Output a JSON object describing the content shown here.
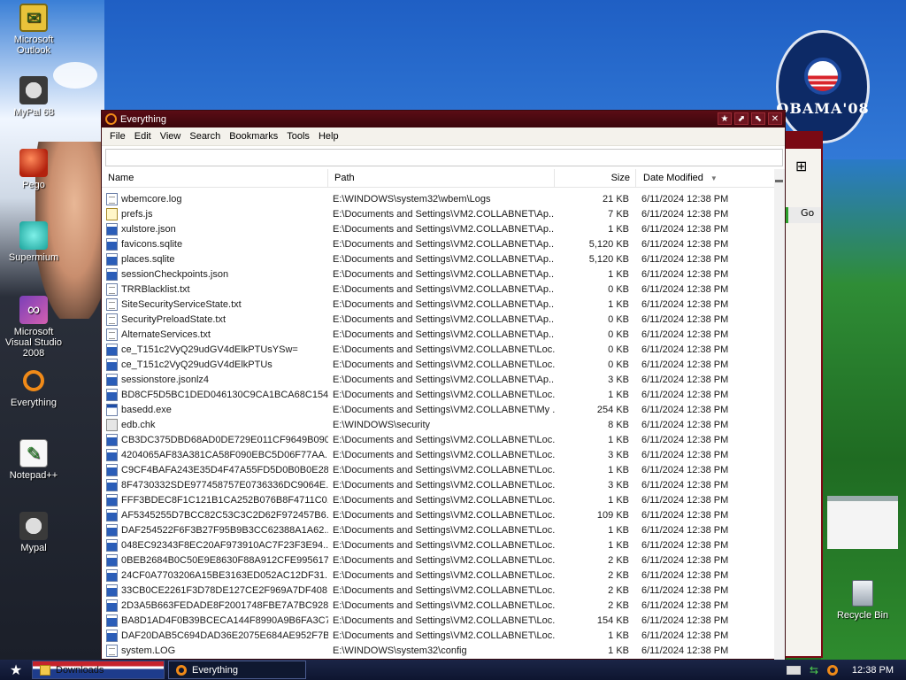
{
  "desktop": {
    "icons": [
      {
        "label": "Microsoft Outlook",
        "icon": "outlook-icon"
      },
      {
        "label": "MyPal 68",
        "icon": "raccoon-icon"
      },
      {
        "label": "Pego",
        "icon": "pego-icon"
      },
      {
        "label": "Supermium",
        "icon": "supermium-icon"
      },
      {
        "label": "Microsoft Visual Studio 2008",
        "icon": "visual-studio-icon"
      },
      {
        "label": "Everything",
        "icon": "everything-icon"
      },
      {
        "label": "Notepad++",
        "icon": "notepad-icon"
      },
      {
        "label": "Mypal",
        "icon": "raccoon-icon"
      }
    ],
    "badge_text": "OBAMA'08",
    "recycle_bin": "Recycle Bin",
    "bg_window_button": "Go"
  },
  "window": {
    "title": "Everything",
    "title_buttons": [
      "★",
      "⬈",
      "⬉",
      "✕"
    ],
    "menu": [
      "File",
      "Edit",
      "View",
      "Search",
      "Bookmarks",
      "Tools",
      "Help"
    ],
    "search": {
      "value": "",
      "placeholder": ""
    },
    "columns": {
      "name": "Name",
      "path": "Path",
      "size": "Size",
      "date": "Date Modified",
      "sort_arrow": "▼"
    },
    "rows": [
      {
        "icon": "doc",
        "name": "wbemcore.log",
        "path": "E:\\WINDOWS\\system32\\wbem\\Logs",
        "size": "21 KB",
        "date": "6/11/2024 12:38 PM"
      },
      {
        "icon": "js",
        "name": "prefs.js",
        "path": "E:\\Documents and Settings\\VM2.COLLABNET\\Ap...",
        "size": "7 KB",
        "date": "6/11/2024 12:38 PM"
      },
      {
        "icon": "blue",
        "name": "xulstore.json",
        "path": "E:\\Documents and Settings\\VM2.COLLABNET\\Ap...",
        "size": "1 KB",
        "date": "6/11/2024 12:38 PM"
      },
      {
        "icon": "blue",
        "name": "favicons.sqlite",
        "path": "E:\\Documents and Settings\\VM2.COLLABNET\\Ap...",
        "size": "5,120 KB",
        "date": "6/11/2024 12:38 PM"
      },
      {
        "icon": "blue",
        "name": "places.sqlite",
        "path": "E:\\Documents and Settings\\VM2.COLLABNET\\Ap...",
        "size": "5,120 KB",
        "date": "6/11/2024 12:38 PM"
      },
      {
        "icon": "blue",
        "name": "sessionCheckpoints.json",
        "path": "E:\\Documents and Settings\\VM2.COLLABNET\\Ap...",
        "size": "1 KB",
        "date": "6/11/2024 12:38 PM"
      },
      {
        "icon": "doc",
        "name": "TRRBlacklist.txt",
        "path": "E:\\Documents and Settings\\VM2.COLLABNET\\Ap...",
        "size": "0 KB",
        "date": "6/11/2024 12:38 PM"
      },
      {
        "icon": "doc",
        "name": "SiteSecurityServiceState.txt",
        "path": "E:\\Documents and Settings\\VM2.COLLABNET\\Ap...",
        "size": "1 KB",
        "date": "6/11/2024 12:38 PM"
      },
      {
        "icon": "doc",
        "name": "SecurityPreloadState.txt",
        "path": "E:\\Documents and Settings\\VM2.COLLABNET\\Ap...",
        "size": "0 KB",
        "date": "6/11/2024 12:38 PM"
      },
      {
        "icon": "doc",
        "name": "AlternateServices.txt",
        "path": "E:\\Documents and Settings\\VM2.COLLABNET\\Ap...",
        "size": "0 KB",
        "date": "6/11/2024 12:38 PM"
      },
      {
        "icon": "blue",
        "name": "ce_T151c2VyQ29udGV4dElkPTUsYSw=",
        "path": "E:\\Documents and Settings\\VM2.COLLABNET\\Loc...",
        "size": "0 KB",
        "date": "6/11/2024 12:38 PM"
      },
      {
        "icon": "blue",
        "name": "ce_T151c2VyQ29udGV4dElkPTUs",
        "path": "E:\\Documents and Settings\\VM2.COLLABNET\\Loc...",
        "size": "0 KB",
        "date": "6/11/2024 12:38 PM"
      },
      {
        "icon": "blue",
        "name": "sessionstore.jsonlz4",
        "path": "E:\\Documents and Settings\\VM2.COLLABNET\\Ap...",
        "size": "3 KB",
        "date": "6/11/2024 12:38 PM"
      },
      {
        "icon": "blue",
        "name": "BD8CF5D5BC1DED046130C9CA1BCA68C154...",
        "path": "E:\\Documents and Settings\\VM2.COLLABNET\\Loc...",
        "size": "1 KB",
        "date": "6/11/2024 12:38 PM"
      },
      {
        "icon": "exe",
        "name": "basedd.exe",
        "path": "E:\\Documents and Settings\\VM2.COLLABNET\\My ...",
        "size": "254 KB",
        "date": "6/11/2024 12:38 PM"
      },
      {
        "icon": "chk",
        "name": "edb.chk",
        "path": "E:\\WINDOWS\\security",
        "size": "8 KB",
        "date": "6/11/2024 12:38 PM"
      },
      {
        "icon": "blue",
        "name": "CB3DC375DBD68AD0DE729E011CF9649B090...",
        "path": "E:\\Documents and Settings\\VM2.COLLABNET\\Loc...",
        "size": "1 KB",
        "date": "6/11/2024 12:38 PM"
      },
      {
        "icon": "blue",
        "name": "4204065AF83A381CA58F090EBC5D06F77AA...",
        "path": "E:\\Documents and Settings\\VM2.COLLABNET\\Loc...",
        "size": "3 KB",
        "date": "6/11/2024 12:38 PM"
      },
      {
        "icon": "blue",
        "name": "C9CF4BAFA243E35D4F47A55FD5D0B0B0E28...",
        "path": "E:\\Documents and Settings\\VM2.COLLABNET\\Loc...",
        "size": "1 KB",
        "date": "6/11/2024 12:38 PM"
      },
      {
        "icon": "blue",
        "name": "8F4730332SDE977458757E0736336DC9064E...",
        "path": "E:\\Documents and Settings\\VM2.COLLABNET\\Loc...",
        "size": "3 KB",
        "date": "6/11/2024 12:38 PM"
      },
      {
        "icon": "blue",
        "name": "FFF3BDEC8F1C121B1CA252B076B8F4711C0...",
        "path": "E:\\Documents and Settings\\VM2.COLLABNET\\Loc...",
        "size": "1 KB",
        "date": "6/11/2024 12:38 PM"
      },
      {
        "icon": "blue",
        "name": "AF5345255D7BCC82C53C3C2D62F972457B6...",
        "path": "E:\\Documents and Settings\\VM2.COLLABNET\\Loc...",
        "size": "109 KB",
        "date": "6/11/2024 12:38 PM"
      },
      {
        "icon": "blue",
        "name": "DAF254522F6F3B27F95B9B3CC62388A1A62...",
        "path": "E:\\Documents and Settings\\VM2.COLLABNET\\Loc...",
        "size": "1 KB",
        "date": "6/11/2024 12:38 PM"
      },
      {
        "icon": "blue",
        "name": "048EC92343F8EC20AF973910AC7F23F3E94...",
        "path": "E:\\Documents and Settings\\VM2.COLLABNET\\Loc...",
        "size": "1 KB",
        "date": "6/11/2024 12:38 PM"
      },
      {
        "icon": "blue",
        "name": "0BEB2684B0C50E9E8630F88A912CFE995617...",
        "path": "E:\\Documents and Settings\\VM2.COLLABNET\\Loc...",
        "size": "2 KB",
        "date": "6/11/2024 12:38 PM"
      },
      {
        "icon": "blue",
        "name": "24CF0A7703206A15BE3163ED052AC12DF31...",
        "path": "E:\\Documents and Settings\\VM2.COLLABNET\\Loc...",
        "size": "2 KB",
        "date": "6/11/2024 12:38 PM"
      },
      {
        "icon": "blue",
        "name": "33CB0CE2261F3D78DE127CE2F969A7DF408...",
        "path": "E:\\Documents and Settings\\VM2.COLLABNET\\Loc...",
        "size": "2 KB",
        "date": "6/11/2024 12:38 PM"
      },
      {
        "icon": "blue",
        "name": "2D3A5B663FEDADE8F2001748FBE7A7BC928...",
        "path": "E:\\Documents and Settings\\VM2.COLLABNET\\Loc...",
        "size": "2 KB",
        "date": "6/11/2024 12:38 PM"
      },
      {
        "icon": "blue",
        "name": "BA8D1AD4F0B39BCECA144F8990A9B6FA3C7...",
        "path": "E:\\Documents and Settings\\VM2.COLLABNET\\Loc...",
        "size": "154 KB",
        "date": "6/11/2024 12:38 PM"
      },
      {
        "icon": "blue",
        "name": "DAF20DAB5C694DAD36E2075E684AE952F7B...",
        "path": "E:\\Documents and Settings\\VM2.COLLABNET\\Loc...",
        "size": "1 KB",
        "date": "6/11/2024 12:38 PM"
      },
      {
        "icon": "doc",
        "name": "system.LOG",
        "path": "E:\\WINDOWS\\system32\\config",
        "size": "1 KB",
        "date": "6/11/2024 12:38 PM"
      }
    ]
  },
  "taskbar": {
    "start_glyph": "★",
    "buttons": [
      {
        "label": "Downloads",
        "icon": "folder-icon"
      },
      {
        "label": "Everything",
        "icon": "everything-icon"
      }
    ],
    "clock": "12:38 PM"
  },
  "colors": {
    "titlebar": "#4a0910",
    "taskbar": "#151f40",
    "accent": "#f08a18"
  }
}
